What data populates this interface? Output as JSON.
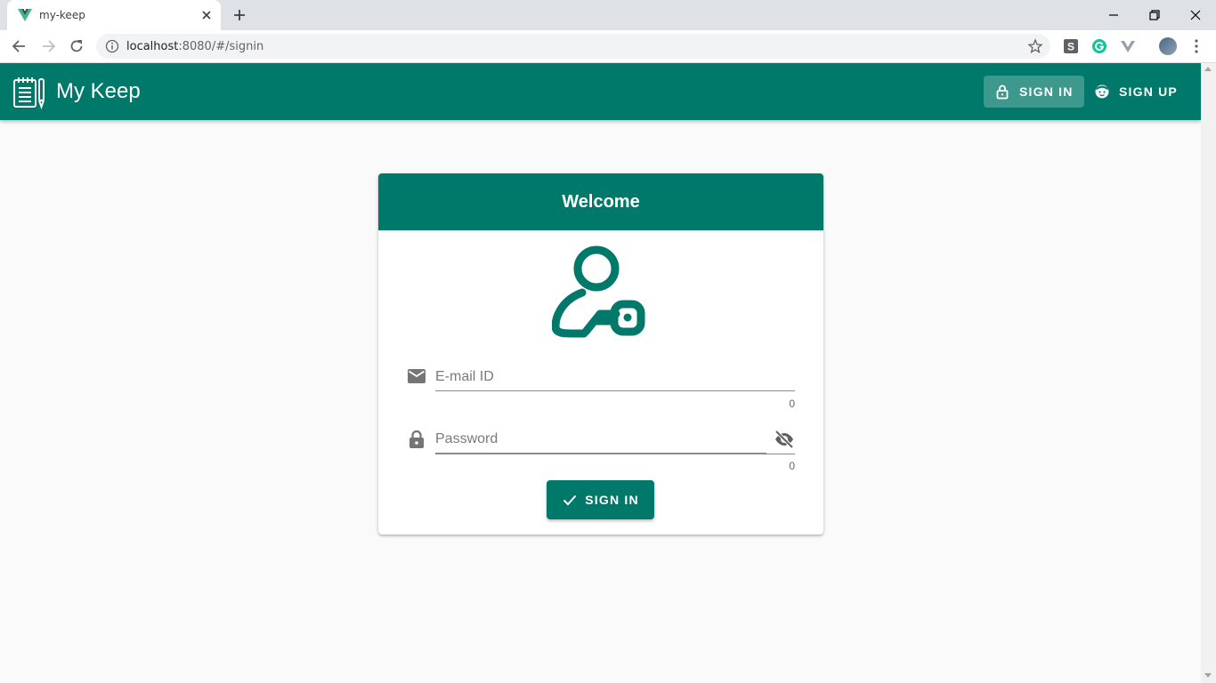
{
  "browser": {
    "tab_title": "my-keep",
    "url_host": "localhost",
    "url_rest": ":8080/#/signin"
  },
  "app": {
    "title": "My Keep",
    "nav": {
      "sign_in": "SIGN IN",
      "sign_up": "SIGN UP"
    }
  },
  "card": {
    "header": "Welcome",
    "email": {
      "placeholder": "E-mail ID",
      "value": "",
      "counter": "0"
    },
    "password": {
      "placeholder": "Password",
      "value": "",
      "counter": "0"
    },
    "submit": "SIGN IN"
  },
  "colors": {
    "primary": "#00796b"
  }
}
